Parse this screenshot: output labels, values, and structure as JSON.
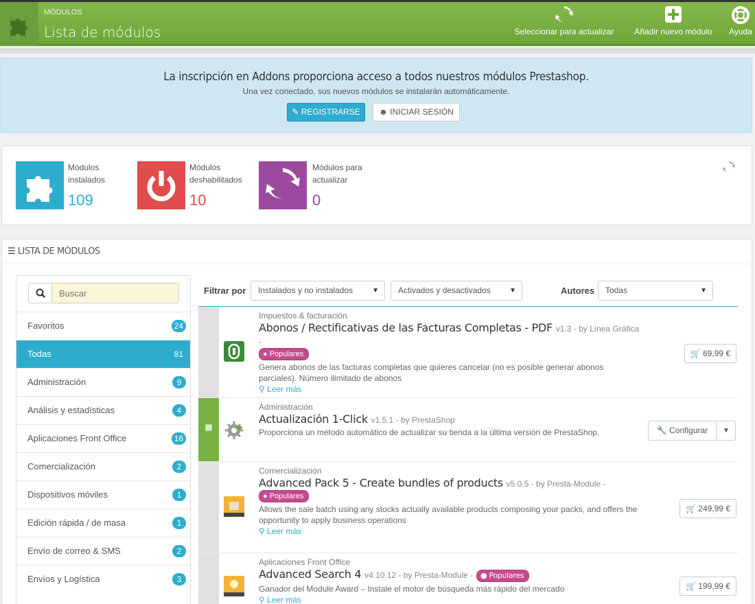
{
  "header": {
    "section": "MÓDULOS",
    "title": "Lista de módulos",
    "buttons": {
      "update_label": "Seleccionar para actualizar",
      "add_label": "Añadir nuevo módulo",
      "help_label": "Ayuda"
    }
  },
  "addons": {
    "headline": "La inscripción en Addons proporciona acceso a todos nuestros módulos Prestashop.",
    "subline": "Una vez conectado, sus nuevos módulos se instalarán automáticamente.",
    "register_label": "REGISTRARSE",
    "login_label": "INICIAR SESIÓN"
  },
  "stats": {
    "installed": {
      "label": "Módulos instalados",
      "value": "109",
      "color": "#2eacce"
    },
    "disabled": {
      "label": "Módulos deshabilitados",
      "value": "10",
      "color": "#e04b4b"
    },
    "to_update": {
      "label": "Módulos para actualizar",
      "value": "0",
      "color": "#9b4aa0"
    }
  },
  "list": {
    "heading": "LISTA DE MÓDULOS",
    "search_placeholder": "Buscar",
    "categories": [
      {
        "label": "Favoritos",
        "count": "24"
      },
      {
        "label": "Todas",
        "count": "81"
      },
      {
        "label": "Administración",
        "count": "9"
      },
      {
        "label": "Análisis y estadísticas",
        "count": "4"
      },
      {
        "label": "Aplicaciones Front Office",
        "count": "16"
      },
      {
        "label": "Comercialización",
        "count": "2"
      },
      {
        "label": "Dispositivos móviles",
        "count": "1"
      },
      {
        "label": "Edición rápida / de masa",
        "count": "1"
      },
      {
        "label": "Envío de correo & SMS",
        "count": "2"
      },
      {
        "label": "Envíos y Logística",
        "count": "3"
      }
    ],
    "filter": {
      "label": "Filtrar por",
      "install_state": "Instalados y no instalados",
      "active_state": "Activados y desactivados",
      "authors_label": "Autores",
      "authors_value": "Todas"
    },
    "modules": [
      {
        "category": "Impuestos & facturación",
        "name": "Abonos / Rectificativas de las Facturas Completas - PDF",
        "version": "v1.3 - by Línea Gráfica -",
        "badge": "Populares",
        "description": "Genera abonos de las facturas completas que quieres cancelar (no es posible generar abonos parciales). Número ilimitado de abonos",
        "more": "Leer más",
        "price": "69,99 €"
      },
      {
        "category": "Administración",
        "name": "Actualización 1-Click",
        "version": "v1.5.1 - by PrestaShop",
        "description": "Proporciona un método automático de actualizar su tienda a la última versión de PrestaShop.",
        "action": "Configurar"
      },
      {
        "category": "Comercialización",
        "name": "Advanced Pack 5 - Create bundles of products",
        "version": "v5.0.5 - by Presta-Module -",
        "badge": "Populares",
        "description": "Allows the sale batch using any stocks actually available products composing your packs, and offers the opportunity to apply business operations",
        "more": "Leer más",
        "price": "249,99 €"
      },
      {
        "category": "Aplicaciones Front Office",
        "name": "Advanced Search 4",
        "version": "v4.10.12 - by Presta-Module -",
        "badge": "Populares",
        "description": "Ganador del Module Award – Instale el motor de búsqueda más rápido del mercado",
        "more": "Leer más",
        "price": "199,99 €"
      }
    ]
  }
}
